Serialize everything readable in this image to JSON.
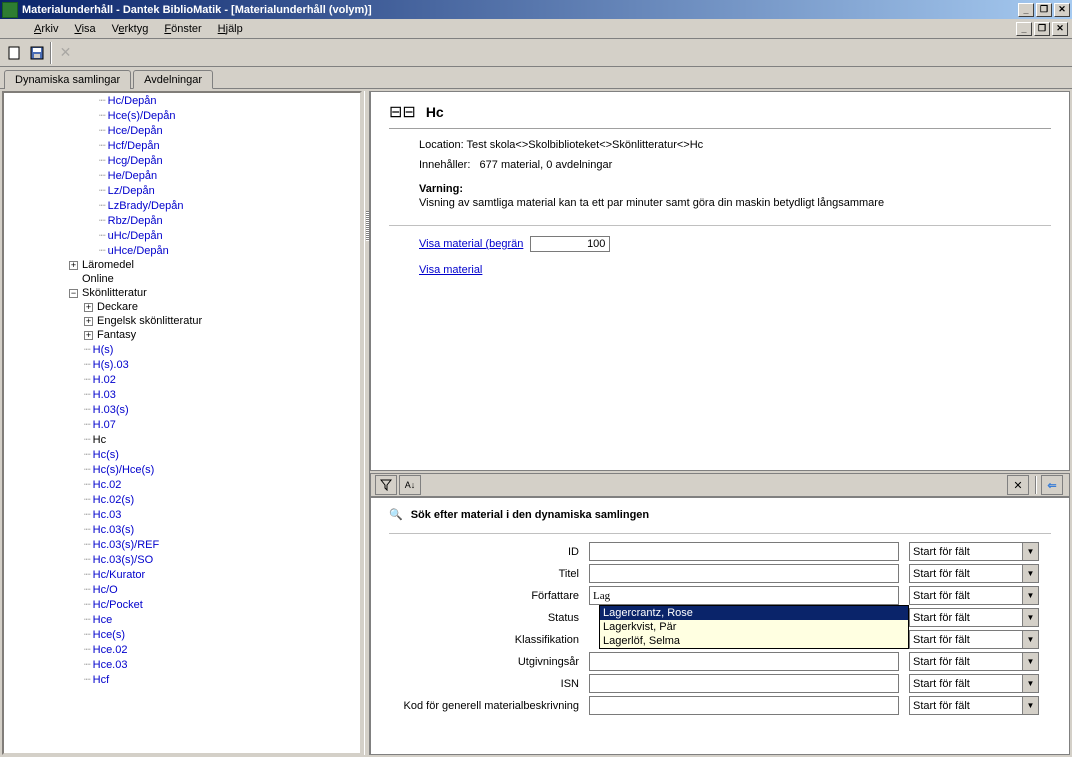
{
  "window": {
    "title": "Materialunderhåll - Dantek BiblioMatik - [Materialunderhåll (volym)]"
  },
  "menu": {
    "arkiv": "Arkiv",
    "visa": "Visa",
    "verktyg": "Verktyg",
    "fonster": "Fönster",
    "hjalp": "Hjälp"
  },
  "tabs": {
    "t1": "Dynamiska samlingar",
    "t2": "Avdelningar"
  },
  "tree": {
    "depan": [
      "Hc/Depån",
      "Hce(s)/Depån",
      "Hce/Depån",
      "Hcf/Depån",
      "Hcg/Depån",
      "He/Depån",
      "Lz/Depån",
      "LzBrady/Depån",
      "Rbz/Depån",
      "uHc/Depån",
      "uHce/Depån"
    ],
    "laromedel": "Läromedel",
    "online": "Online",
    "skon": "Skönlitteratur",
    "skon_sub": [
      "Deckare",
      "Engelsk skönlitteratur",
      "Fantasy"
    ],
    "hc_list": [
      "H(s)",
      "H(s).03",
      "H.02",
      "H.03",
      "H.03(s)",
      "H.07",
      "Hc",
      "Hc(s)",
      "Hc(s)/Hce(s)",
      "Hc.02",
      "Hc.02(s)",
      "Hc.03",
      "Hc.03(s)",
      "Hc.03(s)/REF",
      "Hc.03(s)/SO",
      "Hc/Kurator",
      "Hc/O",
      "Hc/Pocket",
      "Hce",
      "Hce(s)",
      "Hce.02",
      "Hce.03",
      "Hcf"
    ],
    "selected": "Hc"
  },
  "info": {
    "heading": "Hc",
    "loc_label": "Location:",
    "loc_value": "Test skola<>Skolbiblioteket<>Skönlitteratur<>Hc",
    "contains_label": "Innehåller:",
    "contains_value": "677 material, 0 avdelningar",
    "warn_label": "Varning:",
    "warn_text": "Visning av samtliga material kan ta ett par minuter samt göra din maskin betydligt långsammare",
    "link1": "Visa material (begrän",
    "link1_val": "100",
    "link2": "Visa material"
  },
  "search": {
    "heading": "Sök efter material i den dynamiska samlingen",
    "l_id": "ID",
    "l_titel": "Titel",
    "l_forf": "Författare",
    "l_status": "Status",
    "l_klass": "Klassifikation",
    "l_ar": "Utgivningsår",
    "l_isn": "ISN",
    "l_kod": "Kod för generell materialbeskrivning",
    "combo": "Start för fält",
    "forf_value": "Lag",
    "suggestions": [
      "Lagercrantz, Rose",
      "Lagerkvist, Pär",
      "Lagerlöf, Selma"
    ]
  }
}
